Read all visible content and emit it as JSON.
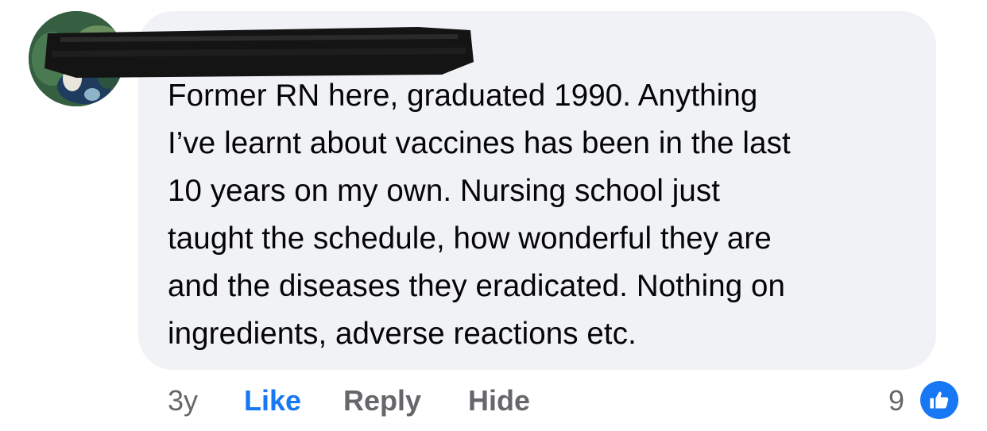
{
  "comment": {
    "author_name_redacted": true,
    "text_lines": [
      "Former RN here, graduated 1990. Anything",
      "I’ve learnt about vaccines has been in the last",
      "10 years on my own. Nursing school just",
      "taught the schedule, how wonderful they are",
      "and the diseases they eradicated. Nothing on",
      "ingredients, adverse reactions etc."
    ],
    "text": "Former RN here, graduated 1990. Anything\nI’ve learnt about vaccines has been in the last\n10 years on my own. Nursing school just\ntaught the schedule, how wonderful they are\nand the diseases they eradicated. Nothing on\ningredients, adverse reactions etc.",
    "bubble_color": "#f0f2f5"
  },
  "actions": {
    "timestamp": "3y",
    "like_label": "Like",
    "reply_label": "Reply",
    "hide_label": "Hide"
  },
  "reactions": {
    "count": "9",
    "icon": "thumbs-up-icon",
    "badge_color": "#1877f2"
  },
  "colors": {
    "link_blue": "#1877f2",
    "muted_gray": "#65676b",
    "text": "#050505"
  }
}
